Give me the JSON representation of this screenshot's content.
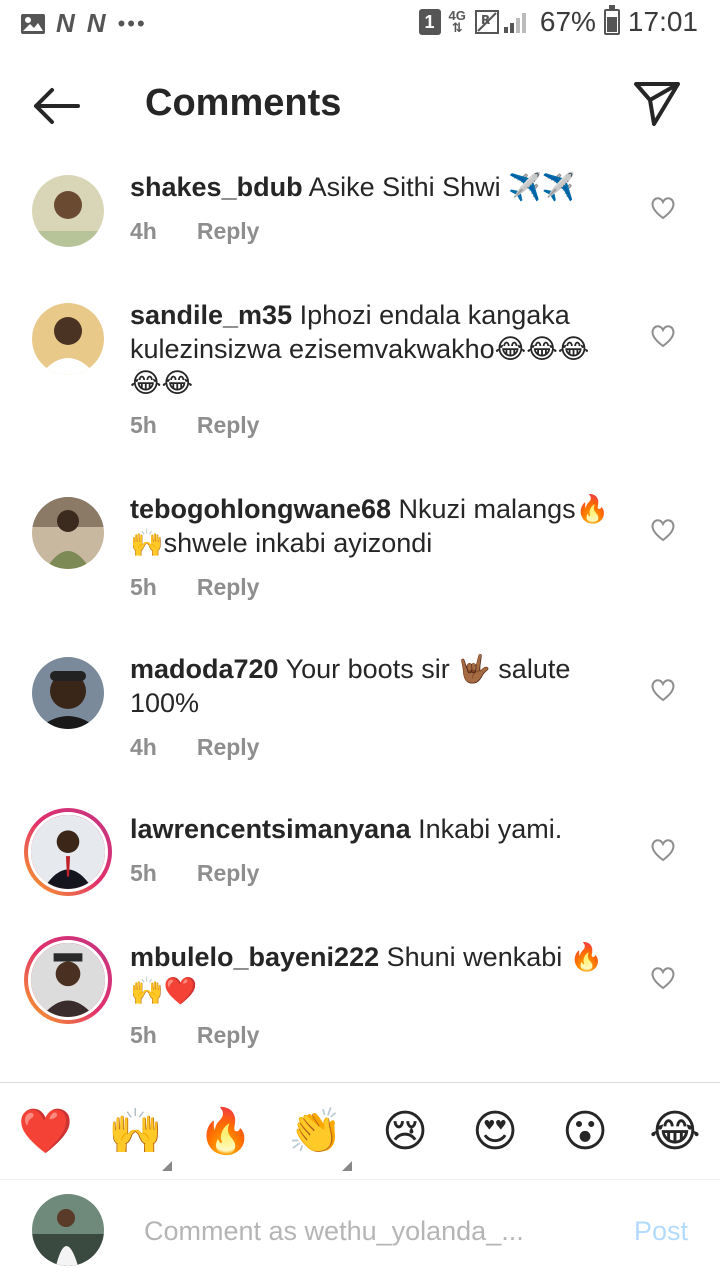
{
  "status_bar": {
    "battery_percent": "67%",
    "time": "17:01",
    "network": "4G",
    "sim_badge": "1",
    "notification_icons": [
      "gallery-icon",
      "news-icon",
      "news-icon"
    ],
    "battery_level": 0.67
  },
  "header": {
    "title": "Comments",
    "back_icon": "arrow-left-icon",
    "send_icon": "paper-plane-icon"
  },
  "comments": [
    {
      "username": "shakes_bdub",
      "text": "Asike Sithi Shwi ✈️✈️",
      "time": "4h",
      "reply_label": "Reply"
    },
    {
      "username": "sandile_m35",
      "text": "Iphozi endala kangaka kulezinsizwa ezisemvakwakho😂😂😂😂😂",
      "time": "5h",
      "reply_label": "Reply"
    },
    {
      "username": "tebogohlongwane68",
      "text": "Nkuzi malangs🔥🙌shwele inkabi ayizondi",
      "time": "5h",
      "reply_label": "Reply"
    },
    {
      "username": "madoda720",
      "text": "Your boots sir 🤟🏾 salute 100%",
      "time": "4h",
      "reply_label": "Reply"
    },
    {
      "username": "lawrencentsimanyana",
      "text": "Inkabi  yami.",
      "time": "5h",
      "reply_label": "Reply"
    },
    {
      "username": "mbulelo_bayeni222",
      "text": "Shuni wenkabi 🔥🙌❤️",
      "time": "5h",
      "reply_label": "Reply"
    }
  ],
  "emoji_bar": [
    "❤️",
    "🙌",
    "🔥",
    "👏",
    "😢",
    "😍",
    "😮",
    "😂"
  ],
  "composer": {
    "placeholder": "Comment as wethu_yolanda_...",
    "post_label": "Post"
  },
  "colors": {
    "accent_disabled": "#b3dbff",
    "meta_gray": "#8e8e8e",
    "story_ring_start": "#f9a825",
    "story_ring_end": "#c13584"
  }
}
